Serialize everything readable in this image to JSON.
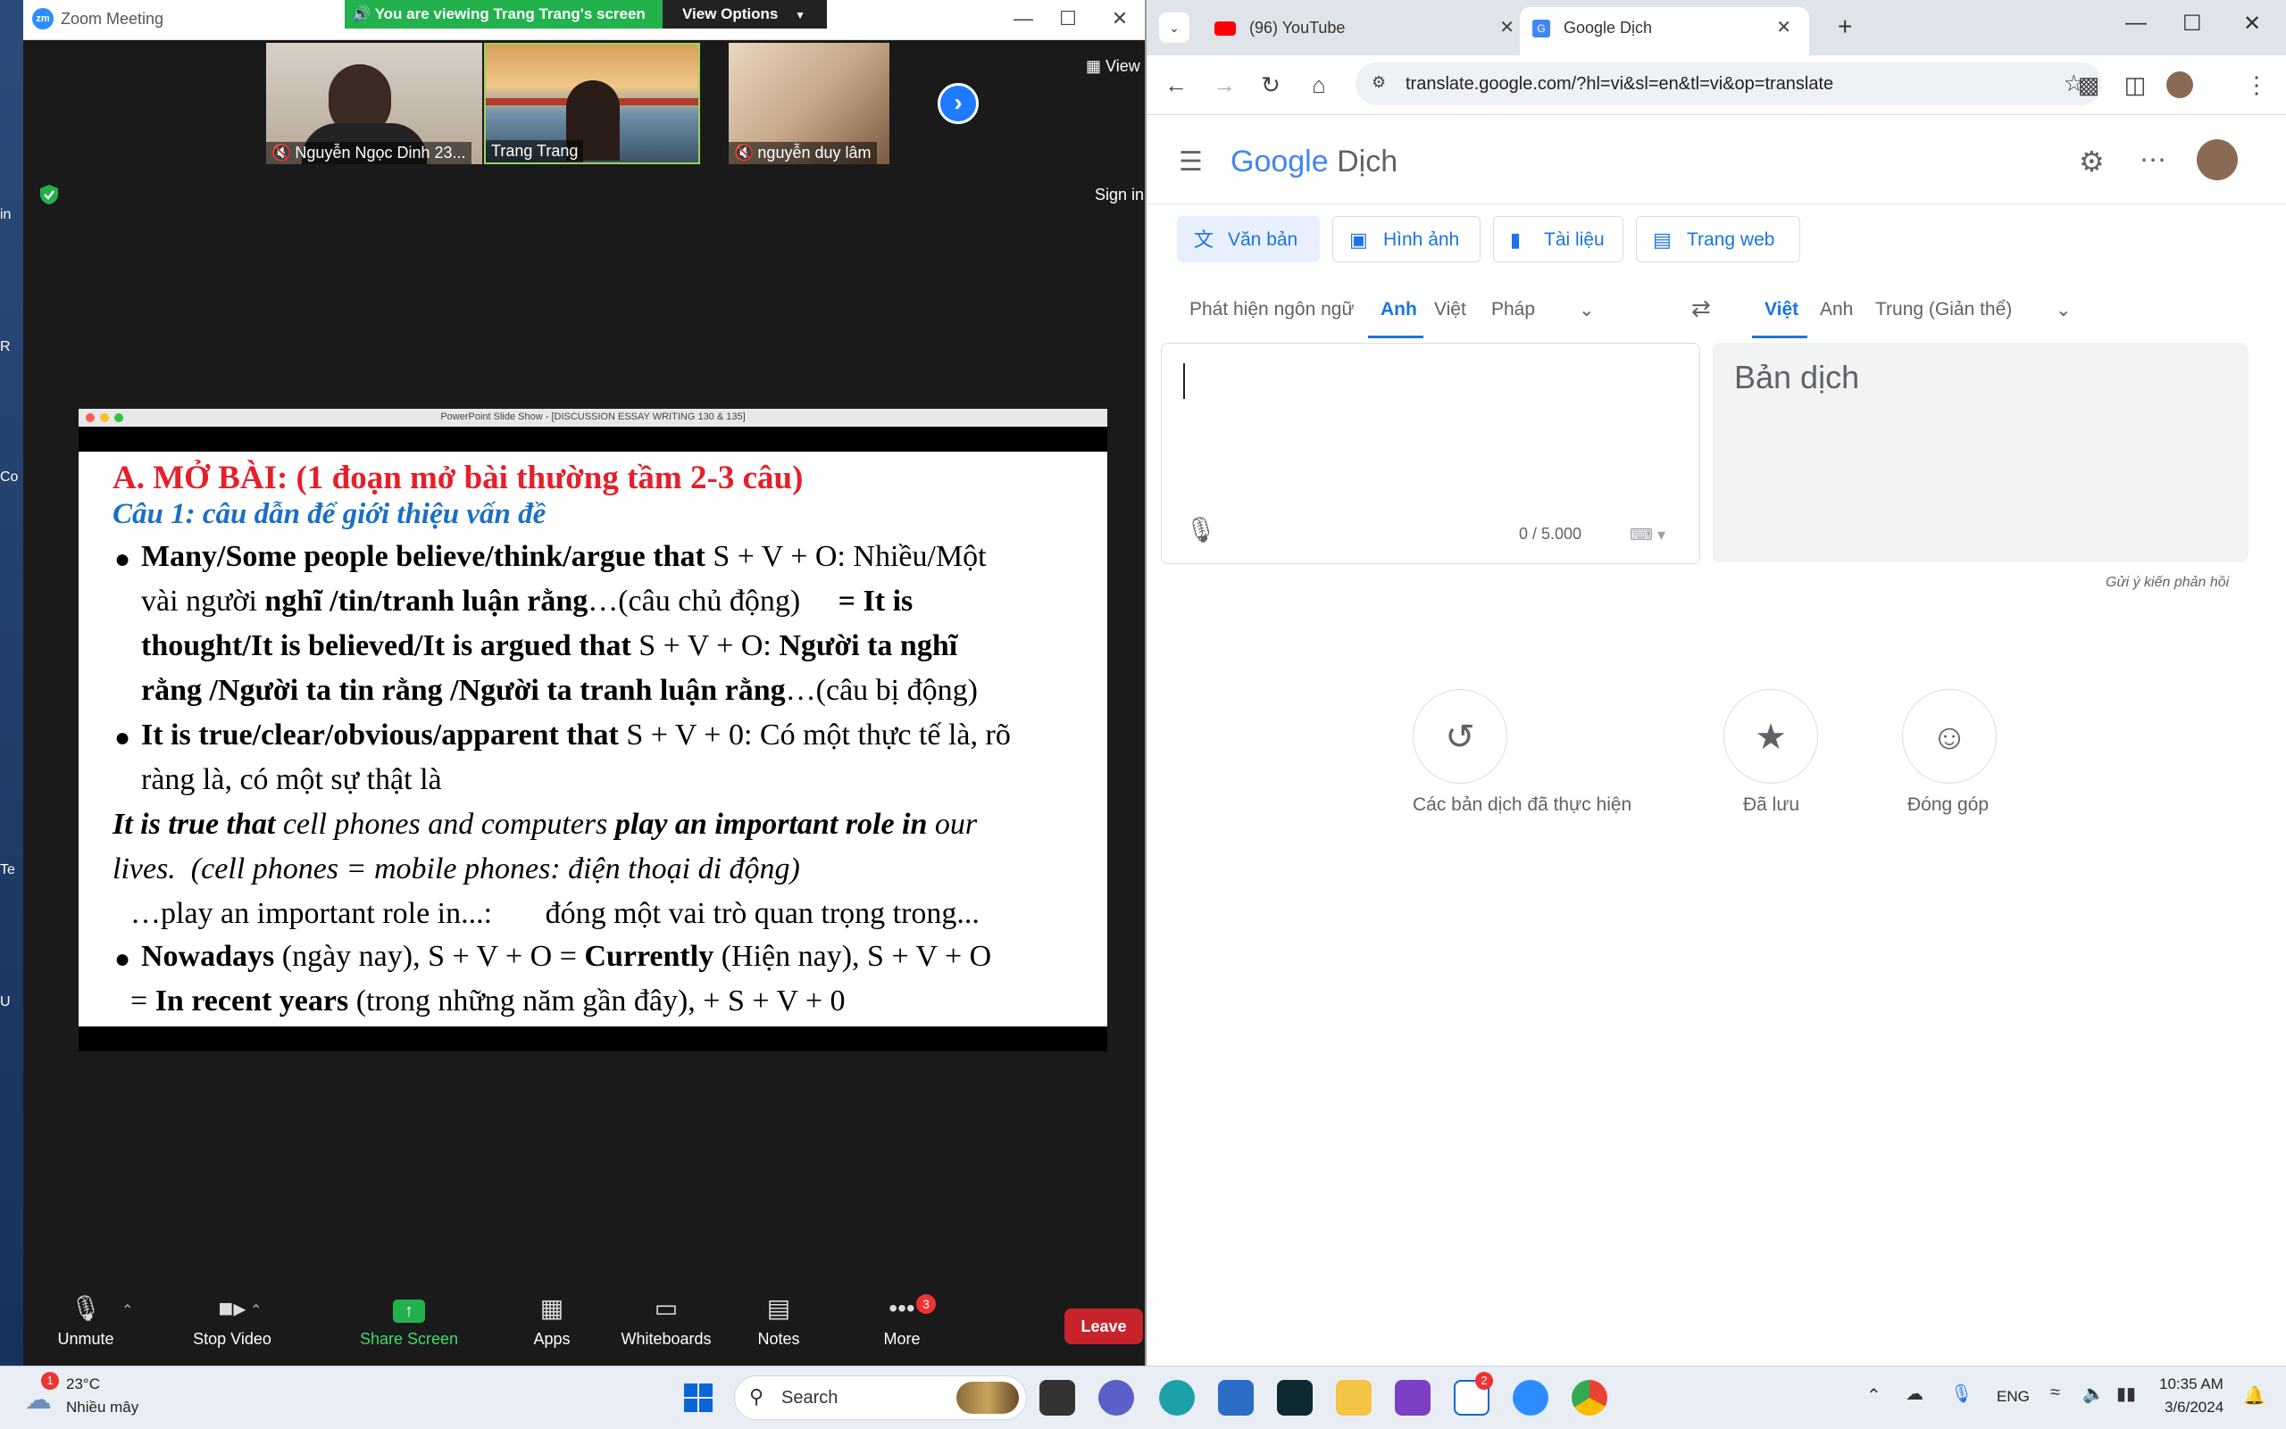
{
  "desktop": {
    "labels": [
      "in",
      "R",
      "Co",
      "Te",
      "U"
    ]
  },
  "zoom": {
    "window_title": "Zoom Meeting",
    "logo_text": "zm",
    "banner": "You are viewing Trang Trang's screen",
    "view_options": "View Options",
    "view_label": "View",
    "sign_in": "Sign in",
    "participants": [
      {
        "name": "Nguyễn Ngọc Dinh 23...",
        "muted": true
      },
      {
        "name": "Trang Trang",
        "muted": false
      },
      {
        "name": "nguyễn duy lâm",
        "muted": true
      }
    ],
    "slide": {
      "window_title": "PowerPoint Slide Show - [DISCUSSION ESSAY WRITING 130 & 135]",
      "heading": "A. MỞ BÀI: (1 đoạn mở bài thường tầm 2-3 câu)",
      "subheading": "Câu 1:  câu dẫn để giới thiệu vấn đề",
      "lines": {
        "b1_l1_bold": "Many/Some people believe/think/argue that",
        "b1_l1_rest": " S + V + O: Nhiều/Một",
        "b1_l2_a": "vài người ",
        "b1_l2_bold": "nghĩ /tin/tranh luận rằng",
        "b1_l2_c": "…(câu chủ động)     ",
        "b1_l2_bold2": "= It is",
        "b1_l3_bold": "thought/It is believed/It is argued that",
        "b1_l3_b": " S + V + O: ",
        "b1_l3_bold2": "Người ta nghĩ",
        "b1_l4_bold": "rằng /Người ta tin rằng /Người ta tranh luận rằng",
        "b1_l4_c": "…(câu bị động)",
        "b2_l1_bold": "It is true/clear/obvious/apparent that",
        "b2_l1_rest": " S + V + 0: Có một thực tế là, rõ",
        "b2_l2": "ràng là, có một sự thật là",
        "ex_l1_bi1": "It is true that",
        "ex_l1_i2": " cell phones and computers ",
        "ex_l1_bi3": "play an important role in",
        "ex_l1_i4": " our",
        "ex_l2": "lives.  (cell phones = mobile phones: điện thoại di động)",
        "ex_l3": "…play an important role in...:       đóng một vai trò quan trọng trong...",
        "b3_l1_bold": "Nowadays",
        "b3_l1_b": " (ngày nay), S + V + O = ",
        "b3_l1_bold2": "Currently",
        "b3_l1_d": " (Hiện nay), S + V + O",
        "b3_l2_a": "= ",
        "b3_l2_bold": "In recent years",
        "b3_l2_c": " (trong những năm gần đây), + S + V + 0"
      }
    },
    "toolbar": {
      "unmute": "Unmute",
      "stop_video": "Stop Video",
      "share_screen": "Share Screen",
      "apps": "Apps",
      "whiteboards": "Whiteboards",
      "notes": "Notes",
      "more": "More",
      "more_badge": "3",
      "leave": "Leave"
    }
  },
  "chrome": {
    "tabs": [
      {
        "title": "(96) YouTube"
      },
      {
        "title": "Google Dịch"
      }
    ],
    "url": "translate.google.com/?hl=vi&sl=en&tl=vi&op=translate",
    "translate": {
      "logo_google": "Google",
      "logo_dich": "Dịch",
      "modes": [
        "Văn bản",
        "Hình ảnh",
        "Tài liệu",
        "Trang web"
      ],
      "source_langs": [
        "Phát hiện ngôn ngữ",
        "Anh",
        "Việt",
        "Pháp"
      ],
      "target_langs": [
        "Việt",
        "Anh",
        "Trung (Giản thể)"
      ],
      "char_count": "0 / 5.000",
      "target_placeholder": "Bản dịch",
      "feedback": "Gửi ý kiến phản hồi",
      "history_label": "Các bản dịch đã thực hiện",
      "saved_label": "Đã lưu",
      "contribute_label": "Đóng góp"
    }
  },
  "taskbar": {
    "weather_badge": "1",
    "weather_temp": "23°C",
    "weather_cond": "Nhiều mây",
    "search": "Search",
    "zalo_badge": "2",
    "lang": "ENG",
    "time": "10:35 AM",
    "date": "3/6/2024"
  },
  "colors": {
    "zoom_banner": "#22b14c",
    "slide_heading": "#e4202a",
    "slide_subheading": "#1a6fc4",
    "google_blue": "#1a73e8",
    "leave_red": "#c8232a"
  }
}
